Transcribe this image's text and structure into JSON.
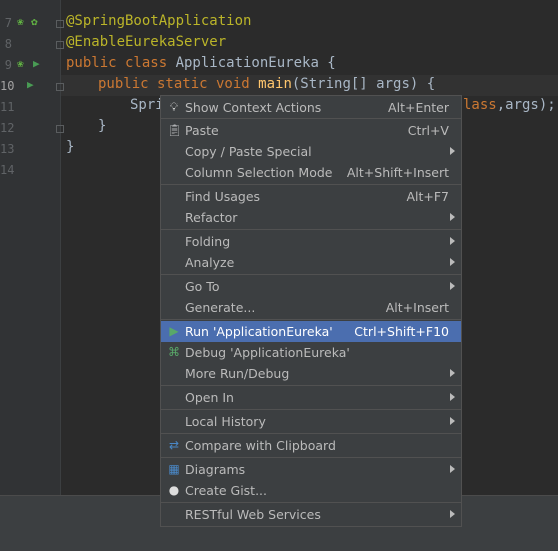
{
  "editor": {
    "line_numbers": [
      "7",
      "8",
      "9",
      "10",
      "11",
      "12",
      "13",
      "14"
    ],
    "lines": {
      "l7": "@SpringBootApplication",
      "l8": "@EnableEurekaServer",
      "l9_kw": "public class ",
      "l9_name": "ApplicationEureka {",
      "l10_kw": "public static void ",
      "l10_fn": "main",
      "l10_rest": "(String[] args) {",
      "l11_left": "Spri",
      "l11_right_kw": "lass",
      "l11_right": ",args);",
      "l12": "}",
      "l13": "}"
    }
  },
  "menu": {
    "items": [
      {
        "label": "Show Context Actions",
        "shortcut": "Alt+Enter",
        "icon": "lightbulb-icon"
      },
      {
        "label": "Paste",
        "shortcut": "Ctrl+V",
        "icon": "clipboard-icon"
      },
      {
        "label": "Copy / Paste Special",
        "shortcut": "",
        "submenu": true
      },
      {
        "label": "Column Selection Mode",
        "shortcut": "Alt+Shift+Insert"
      },
      {
        "label": "Find Usages",
        "shortcut": "Alt+F7"
      },
      {
        "label": "Refactor",
        "shortcut": "",
        "submenu": true
      },
      {
        "label": "Folding",
        "shortcut": "",
        "submenu": true
      },
      {
        "label": "Analyze",
        "shortcut": "",
        "submenu": true
      },
      {
        "label": "Go To",
        "shortcut": "",
        "submenu": true
      },
      {
        "label": "Generate...",
        "shortcut": "Alt+Insert"
      },
      {
        "label": "Run 'ApplicationEureka'",
        "shortcut": "Ctrl+Shift+F10",
        "icon": "run-icon",
        "selected": true
      },
      {
        "label": "Debug 'ApplicationEureka'",
        "shortcut": "",
        "icon": "debug-icon"
      },
      {
        "label": "More Run/Debug",
        "shortcut": "",
        "submenu": true
      },
      {
        "label": "Open In",
        "shortcut": "",
        "submenu": true
      },
      {
        "label": "Local History",
        "shortcut": "",
        "submenu": true
      },
      {
        "label": "Compare with Clipboard",
        "shortcut": "",
        "icon": "compare-icon"
      },
      {
        "label": "Diagrams",
        "shortcut": "",
        "submenu": true,
        "icon": "diagram-icon"
      },
      {
        "label": "Create Gist...",
        "shortcut": "",
        "icon": "github-icon"
      },
      {
        "label": "RESTful Web Services",
        "shortcut": "",
        "submenu": true
      }
    ]
  },
  "colors": {
    "selection": "#4b6eaf",
    "menu_bg": "#3c3f41",
    "editor_bg": "#2b2b2b"
  }
}
